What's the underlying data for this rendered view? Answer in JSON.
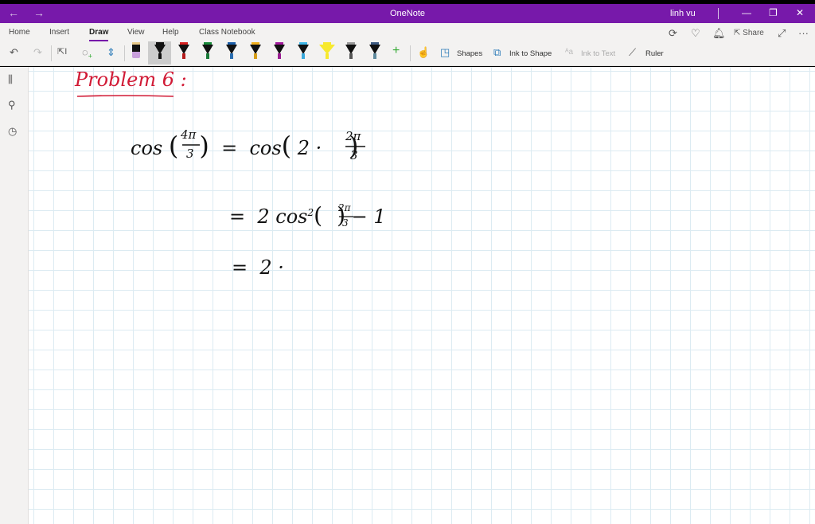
{
  "window": {
    "title": "OneNote",
    "user": "linh vu",
    "back": "←",
    "forward": "→",
    "minimize": "—",
    "restore": "❐",
    "close": "✕"
  },
  "tabs": [
    {
      "label": "Home"
    },
    {
      "label": "Insert"
    },
    {
      "label": "Draw",
      "active": true
    },
    {
      "label": "View"
    },
    {
      "label": "Help"
    },
    {
      "label": "Class Notebook"
    }
  ],
  "right_actions": {
    "share": "Share"
  },
  "draw_tools": {
    "shapes": "Shapes",
    "ink_to_shape": "Ink to Shape",
    "ink_to_text": "Ink to Text",
    "ruler": "Ruler"
  },
  "pens": [
    {
      "name": "eraser",
      "cap": "#e8c98a",
      "tip": "#c9a0dc"
    },
    {
      "name": "black-pen-selected",
      "cap": "#111",
      "tip": "#111"
    },
    {
      "name": "red-pen",
      "cap": "#d62222",
      "tip": "#b51b1b"
    },
    {
      "name": "green-pen",
      "cap": "#1a8a3a",
      "tip": "#1a7a38"
    },
    {
      "name": "blue-pen",
      "cap": "#1c5ea8",
      "tip": "#2a6db0"
    },
    {
      "name": "orange-pen",
      "cap": "#f2b01e",
      "tip": "#d69e1a"
    },
    {
      "name": "purple-pen",
      "cap": "#a21a9c",
      "tip": "#9a1f92"
    },
    {
      "name": "cyan-pen",
      "cap": "#3fb7e8",
      "tip": "#3aa9dc"
    },
    {
      "name": "yellow-highlighter",
      "cap": "#f7e92e",
      "tip": "#f7e92e"
    },
    {
      "name": "galaxy-pen",
      "cap": "#999",
      "tip": "#555"
    },
    {
      "name": "ocean-pen",
      "cap": "#3d5a80",
      "tip": "#5f8a9e"
    }
  ],
  "note": {
    "heading": "Problem 6 :",
    "heading_color": "#d11a35",
    "lines": [
      "cos(4π/3) = cos(2 · 2π/3)",
      "= 2 cos²(2π/3) − 1",
      "= 2 ·"
    ]
  }
}
